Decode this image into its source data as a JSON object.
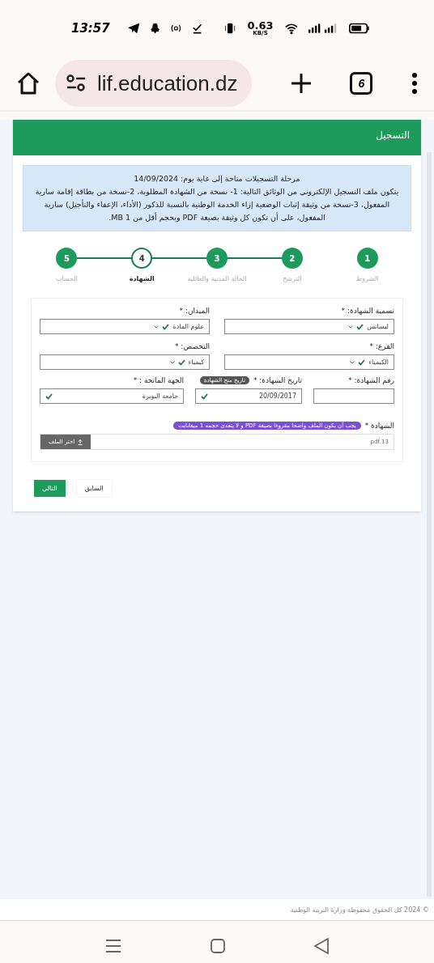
{
  "status_bar": {
    "time": "13:57",
    "speed": "0.63",
    "speed_unit": "KB/S"
  },
  "browser": {
    "url": "lif.education.dz",
    "tab_count": "6"
  },
  "card": {
    "title": "التسجيل",
    "notice": {
      "headline": "مرحلة التسجيلات متاحة إلى غاية يوم: 14/09/2024",
      "body": "يتكون ملف التسجيل الإلكتروني من الوثائق التالية: 1- نسخة من الشهادة المطلوبة، 2-نسخة من بطاقة إقامة سارية المفعول، 3-نسخة من وثيقة إثبات الوضعية إزاء الخدمة الوطنية بالنسبة للذكور (الأداء، الإعفاء والتأجيل) سارية المفعول، على أن تكون كل وثيقة بصيغة PDF وبحجم أقل من MB 1."
    },
    "steps": [
      {
        "number": "1",
        "label": "الشروط",
        "current": false
      },
      {
        "number": "2",
        "label": "الترشح",
        "current": false
      },
      {
        "number": "3",
        "label": "الحالة المدنية والعائلية",
        "current": false
      },
      {
        "number": "4",
        "label": "الشهادة",
        "current": true
      },
      {
        "number": "5",
        "label": "الحساب",
        "current": false
      }
    ],
    "fields": [
      {
        "kind": "select",
        "label": "تسمية الشهادة: *",
        "value": "ليسانس",
        "valid": true
      },
      {
        "kind": "select",
        "label": "الميدان: *",
        "value": "علوم المادة",
        "valid": true
      },
      {
        "kind": "select",
        "label": "الفرع: *",
        "value": "الكيمياء",
        "valid": true
      },
      {
        "kind": "select",
        "label": "التخصص: *",
        "value": "كيمياء",
        "valid": true
      },
      {
        "kind": "text",
        "label": "رقم الشهادة: *"
      },
      {
        "kind": "text",
        "label": "تاريخ الشهادة: *",
        "value": "20/09/2017",
        "valid": true,
        "badge": "تاريخ منح الشهادة"
      },
      {
        "kind": "text",
        "label": "الجهة المانحة : *",
        "value": "جامعة البويرة",
        "valid": true
      }
    ],
    "upload": {
      "label": "الشهادة *",
      "hint": "يجب أن يكون الملف واضحا مقروءا بصيغة PDF و لا يتعدى حجمه 1 ميغابايت",
      "file": "13.pdf",
      "button": "اختر الملف"
    },
    "buttons": [
      {
        "label": "السابق",
        "primary": false
      },
      {
        "label": "التالي",
        "primary": true
      }
    ]
  },
  "footer": "© 2024 كل الحقوق محفوظة وزارة التربية الوطنية"
}
